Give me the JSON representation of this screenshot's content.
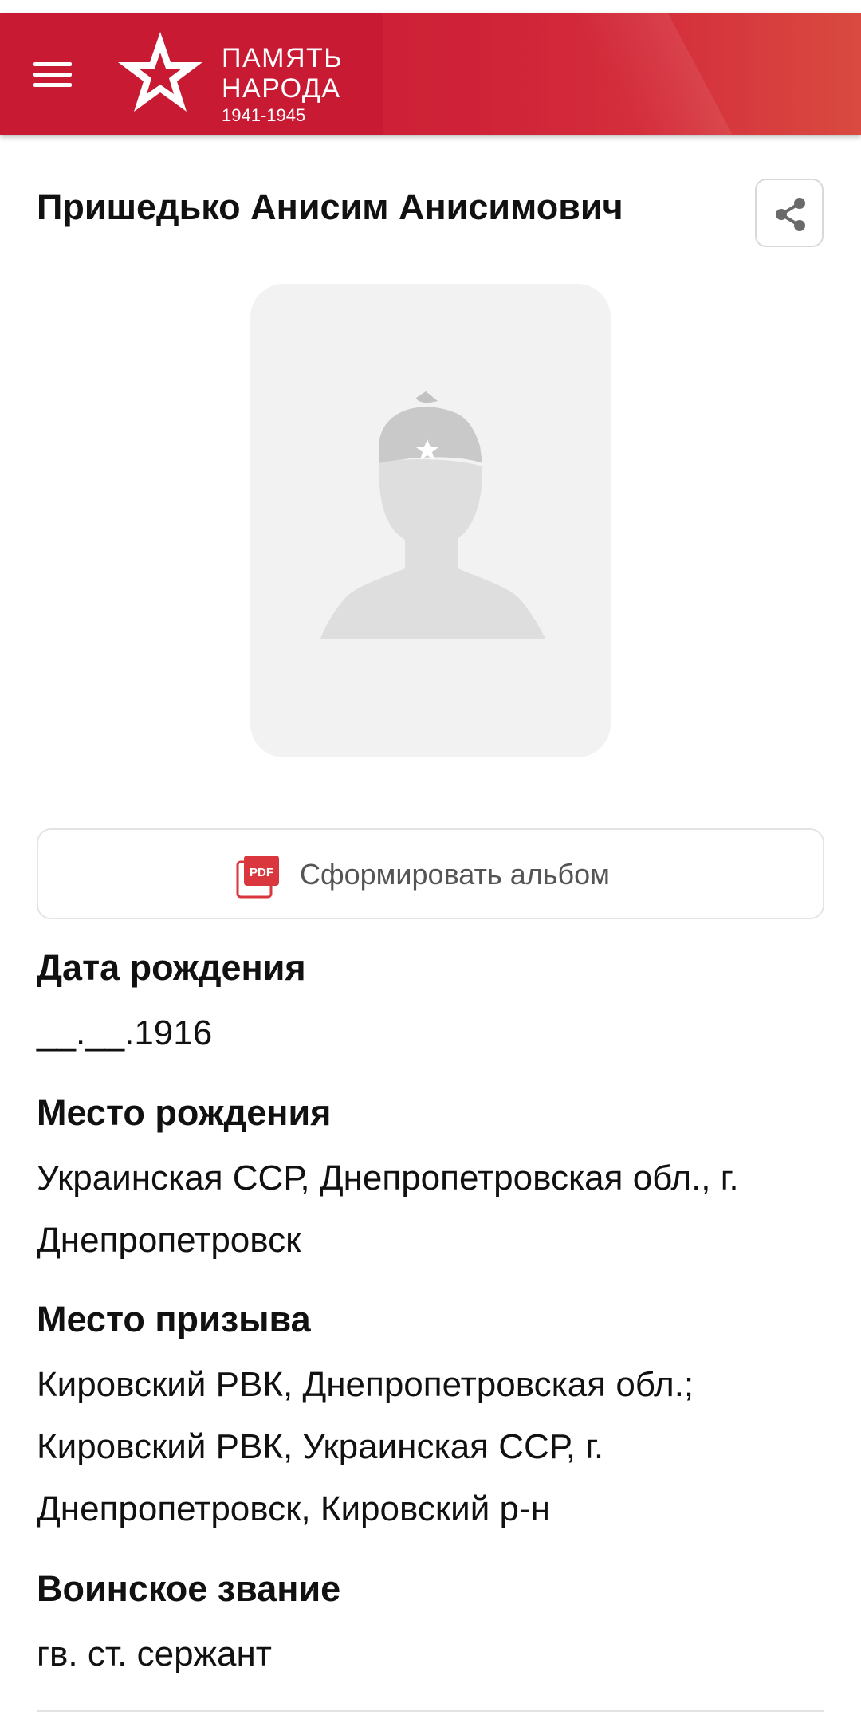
{
  "header": {
    "logo_line1": "ПАМЯТЬ",
    "logo_line2": "НАРОДА",
    "logo_years": "1941-1945",
    "brand_color": "#c91d32"
  },
  "person": {
    "name": "Пришедько Анисим Анисимович"
  },
  "album_button": {
    "label": "Сформировать альбом",
    "icon": "pdf-icon"
  },
  "fields": [
    {
      "label": "Дата рождения",
      "value": "__.__.1916"
    },
    {
      "label": "Место рождения",
      "value": "Украинская ССР, Днепропетровская обл., г. Днепропетровск"
    },
    {
      "label": "Место призыва",
      "value": "Кировский РВК, Днепропетровская обл.; Кировский РВК, Украинская ССР, г. Днепропетровск, Кировский р-н"
    },
    {
      "label": "Воинское звание",
      "value": "гв. ст. сержант"
    }
  ]
}
